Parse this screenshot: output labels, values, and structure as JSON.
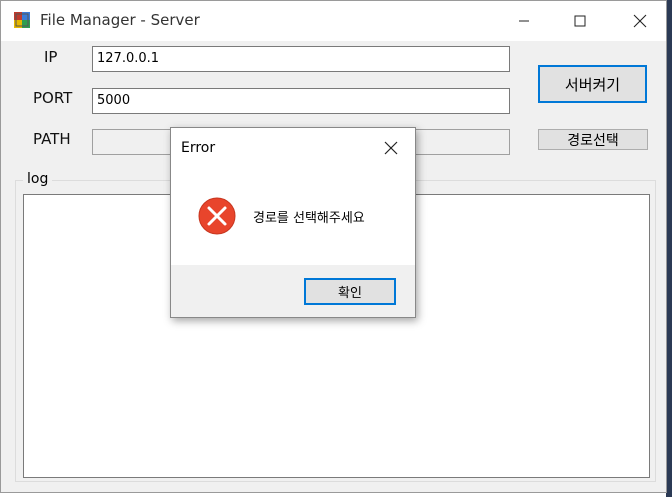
{
  "window": {
    "title": "File Manager - Server"
  },
  "form": {
    "ip_label": "IP",
    "ip_value": "127.0.0.1",
    "port_label": "PORT",
    "port_value": "5000",
    "path_label": "PATH",
    "path_value": "",
    "start_server_button": "서버켜기",
    "select_path_button": "경로선택",
    "log_group_label": "log"
  },
  "dialog": {
    "title": "Error",
    "message": "경로를 선택해주세요",
    "ok_button": "확인",
    "icon": "error-icon"
  },
  "colors": {
    "accent": "#0078d7",
    "error": "#e81123"
  }
}
